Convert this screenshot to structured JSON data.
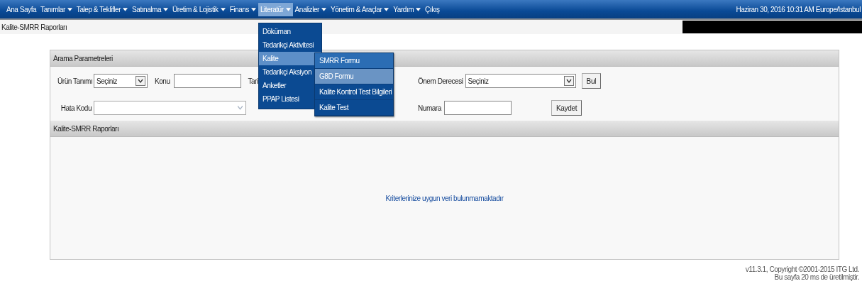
{
  "nav": {
    "items": [
      {
        "label": "Ana Sayfa",
        "has_menu": false,
        "selected": false
      },
      {
        "label": "Tanımlar",
        "has_menu": true,
        "selected": false
      },
      {
        "label": "Talep & Teklifler",
        "has_menu": true,
        "selected": false
      },
      {
        "label": "Satınalma",
        "has_menu": true,
        "selected": false
      },
      {
        "label": "Üretim & Lojistik",
        "has_menu": true,
        "selected": false
      },
      {
        "label": "Finans",
        "has_menu": true,
        "selected": false
      },
      {
        "label": "Literatür",
        "has_menu": true,
        "selected": true,
        "menu": [
          {
            "label": "Döküman",
            "selected": false
          },
          {
            "label": "Tedarikçi Aktivitesi",
            "selected": false
          },
          {
            "label": "Kalite",
            "selected": true,
            "submenu": [
              {
                "label": "SMRR Formu",
                "focused": true,
                "selected": false
              },
              {
                "label": "G8D Formu",
                "focused": false,
                "selected": true
              },
              {
                "label": "Kalite Kontrol Test Bilgileri",
                "focused": false,
                "selected": false
              },
              {
                "label": "Kalite Test",
                "focused": false,
                "selected": false
              }
            ]
          },
          {
            "label": "Tedarikçi Aksiyon",
            "selected": false
          },
          {
            "label": "Anketler",
            "selected": false
          },
          {
            "label": "PPAP Listesi",
            "selected": false
          }
        ]
      },
      {
        "label": "Analizler",
        "has_menu": true,
        "selected": false
      },
      {
        "label": "Yönetim & Araçlar",
        "has_menu": true,
        "selected": false
      },
      {
        "label": "Yardım",
        "has_menu": true,
        "selected": false
      },
      {
        "label": "Çıkış",
        "has_menu": false,
        "selected": false
      }
    ],
    "datetime": "Haziran 30, 2016 10:31 AM Europe/Istanbul"
  },
  "breadcrumb": "Kalite-SMRR Raporları",
  "search": {
    "title": "Arama Parametreleri",
    "product": {
      "label": "Ürün Tanımı",
      "value": "Seçiniz"
    },
    "subject": {
      "label": "Konu"
    },
    "date": {
      "label": "Tari"
    },
    "priority": {
      "label": "Önem Derecesi",
      "value": "Seçiniz"
    },
    "find_button": "Bul",
    "error_code": {
      "label": "Hata Kodu",
      "disabled": true
    },
    "number": {
      "label": "Numara"
    },
    "save_button": "Kaydet"
  },
  "results": {
    "title": "Kalite-SMRR Raporları",
    "empty_message": "Kriterlerinize uygun veri bulunmamaktadır"
  },
  "footer": {
    "copyright": "v11.3.1, Copyright ©2001-2015 ITG Ltd.",
    "timing": "Bu sayfa 20 ms de üretilmiştir."
  }
}
